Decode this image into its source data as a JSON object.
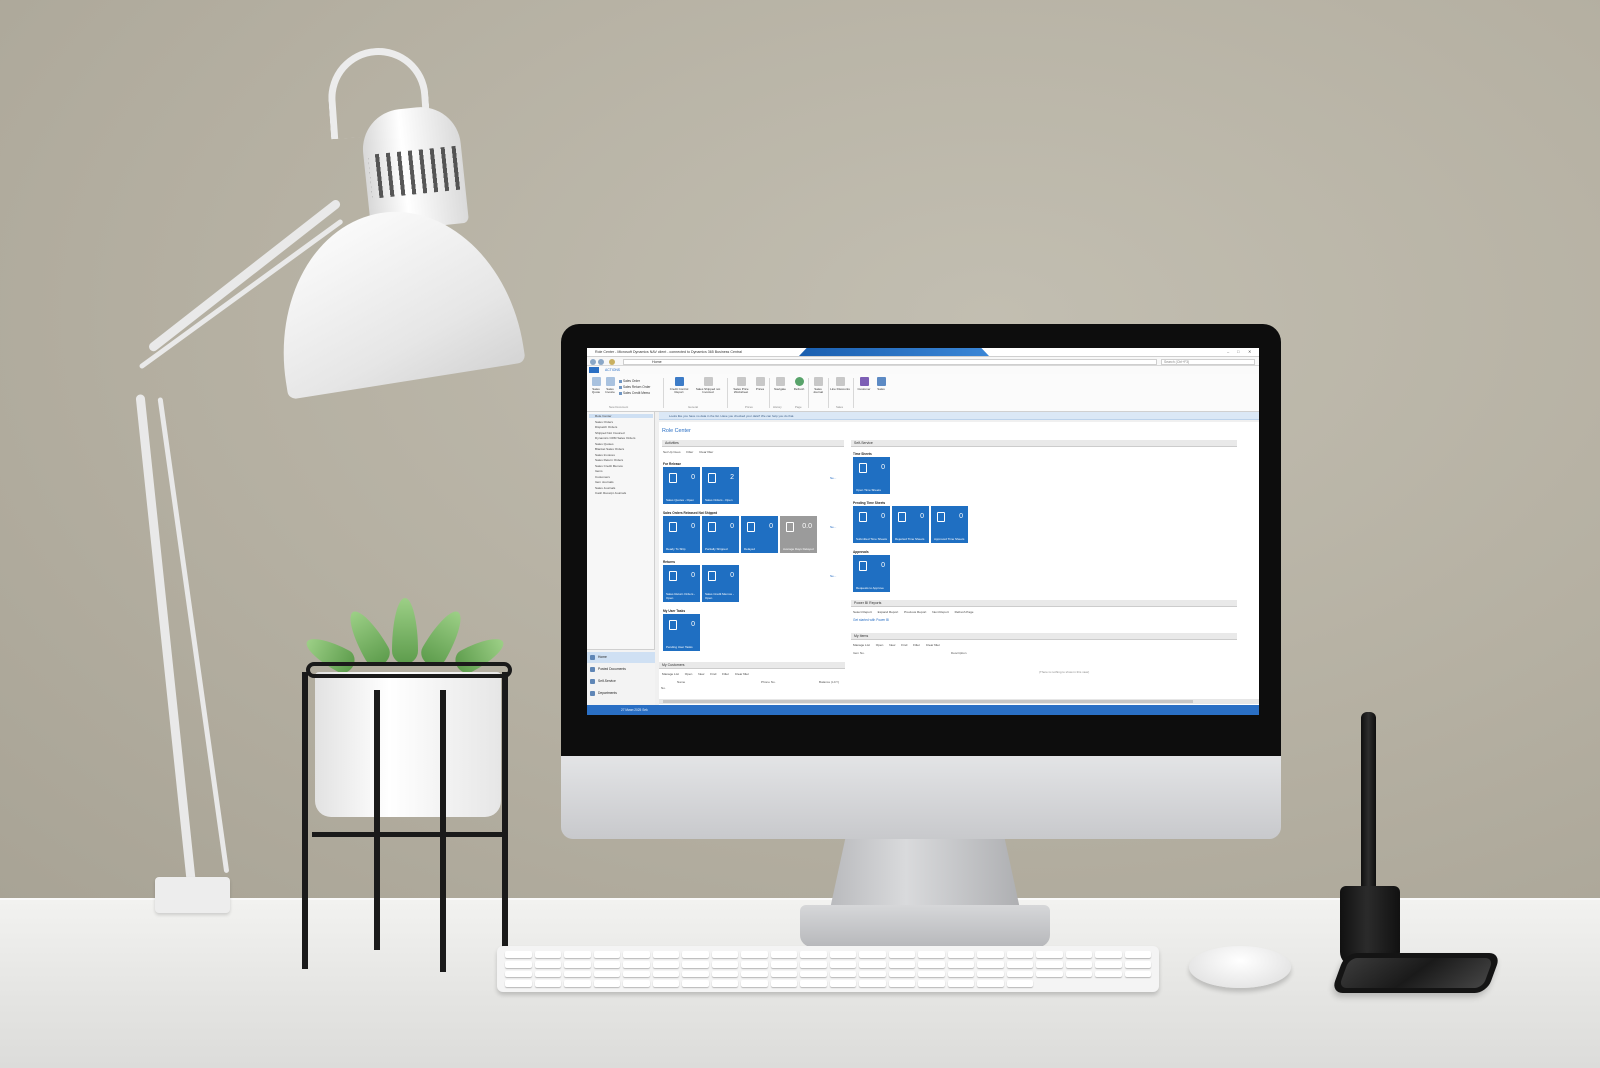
{
  "window": {
    "title": "Role Center - Microsoft Dynamics NAV client - connected to Dynamics 365 Business Central",
    "banner": "",
    "address": "Home",
    "search_placeholder": "Search (Ctrl+F3)"
  },
  "ribbon": {
    "file_tab": "",
    "actions_tab": "ACTIONS",
    "buttons": [
      {
        "label": "Sales Quote"
      },
      {
        "label": "Sales Invoice"
      },
      {
        "label": "Credit Control Report"
      },
      {
        "label": "Sales Shipped not Invoiced"
      },
      {
        "label": "Sales Price Worksheet"
      },
      {
        "label": "Prices"
      },
      {
        "label": "Navigate"
      },
      {
        "label": "Refresh"
      },
      {
        "label": "Sales Journal"
      },
      {
        "label": "Line Discounts"
      },
      {
        "label": "Customer"
      },
      {
        "label": "Sales"
      }
    ],
    "small": [
      "Sales Order",
      "Sales Return Order",
      "Sales Credit Memo"
    ],
    "groups": [
      "New Document",
      "General",
      "Prices",
      "History",
      "Page",
      "Sales"
    ]
  },
  "infobar": "Looks like you have no data in the list. Have you checked your data? We can help you do that.",
  "navpane": {
    "items": [
      "Role Center",
      "Sales Orders",
      "Dispatch Orders",
      "Shipped Not Invoiced",
      "Dynamics CRM Sales Orders",
      "Sales Quotes",
      "Blanket Sales Orders",
      "Sales Invoices",
      "Sales Return Orders",
      "Sales Credit Memos",
      "Items",
      "Customers",
      "Item Journals",
      "Sales Journals",
      "Cash Receipt Journals"
    ],
    "bottom": [
      "Home",
      "Posted Documents",
      "Self-Service",
      "Departments"
    ]
  },
  "content": {
    "title": "Role Center",
    "activities": {
      "header": "Activities",
      "toolbar": [
        "Set Up Cues",
        "Filter",
        "Clear filter"
      ],
      "sections": [
        {
          "label": "For Release",
          "tiles": [
            {
              "value": "0",
              "label": "Sales Quotes - Open"
            },
            {
              "value": "2",
              "label": "Sales Orders - Open"
            }
          ]
        },
        {
          "label": "Sales Orders Released Not Shipped",
          "tiles": [
            {
              "value": "0",
              "label": "Ready To Ship"
            },
            {
              "value": "0",
              "label": "Partially Shipped"
            },
            {
              "value": "0",
              "label": "Delayed"
            },
            {
              "value": "0.0",
              "label": "Average Days Delayed"
            }
          ]
        },
        {
          "label": "Returns",
          "tiles": [
            {
              "value": "0",
              "label": "Sales Return Orders - Open"
            },
            {
              "value": "0",
              "label": "Sales Credit Memos - Open"
            }
          ]
        },
        {
          "label": "My User Tasks",
          "tiles": [
            {
              "value": "0",
              "label": "Pending User Tasks"
            }
          ]
        }
      ],
      "more": "Ne..."
    },
    "customers": {
      "header": "My Customers",
      "toolbar": [
        "Manage List",
        "Open",
        "New",
        "Find",
        "Filter",
        "Clear filter"
      ],
      "columns": [
        "No.",
        "Name",
        "Phone No.",
        "Balance (LCY)"
      ]
    },
    "self_service": {
      "header": "Self-Service",
      "sections": [
        {
          "label": "Time Sheets",
          "tiles": [
            {
              "value": "0",
              "label": "Open Time Sheets"
            }
          ]
        },
        {
          "label": "Pending Time Sheets",
          "tiles": [
            {
              "value": "0",
              "label": "Submitted Time Sheets"
            },
            {
              "value": "0",
              "label": "Rejected Time Sheets"
            },
            {
              "value": "0",
              "label": "Approved Time Sheets"
            }
          ]
        },
        {
          "label": "Approvals",
          "tiles": [
            {
              "value": "0",
              "label": "Requests to Approve"
            }
          ]
        }
      ]
    },
    "powerbi": {
      "header": "Power BI Reports",
      "toolbar": [
        "Select Report",
        "Expand Report",
        "Previous Report",
        "Next Report",
        "Refresh Page"
      ],
      "link": "Get started with Power BI"
    },
    "items": {
      "header": "My Items",
      "toolbar": [
        "Manage List",
        "Open",
        "New",
        "Find",
        "Filter",
        "Clear filter"
      ],
      "columns": [
        "Item No.",
        "Description"
      ],
      "empty": "(There is nothing to show in this view)"
    }
  },
  "statusbar": "27 Миян 2025 Sek"
}
